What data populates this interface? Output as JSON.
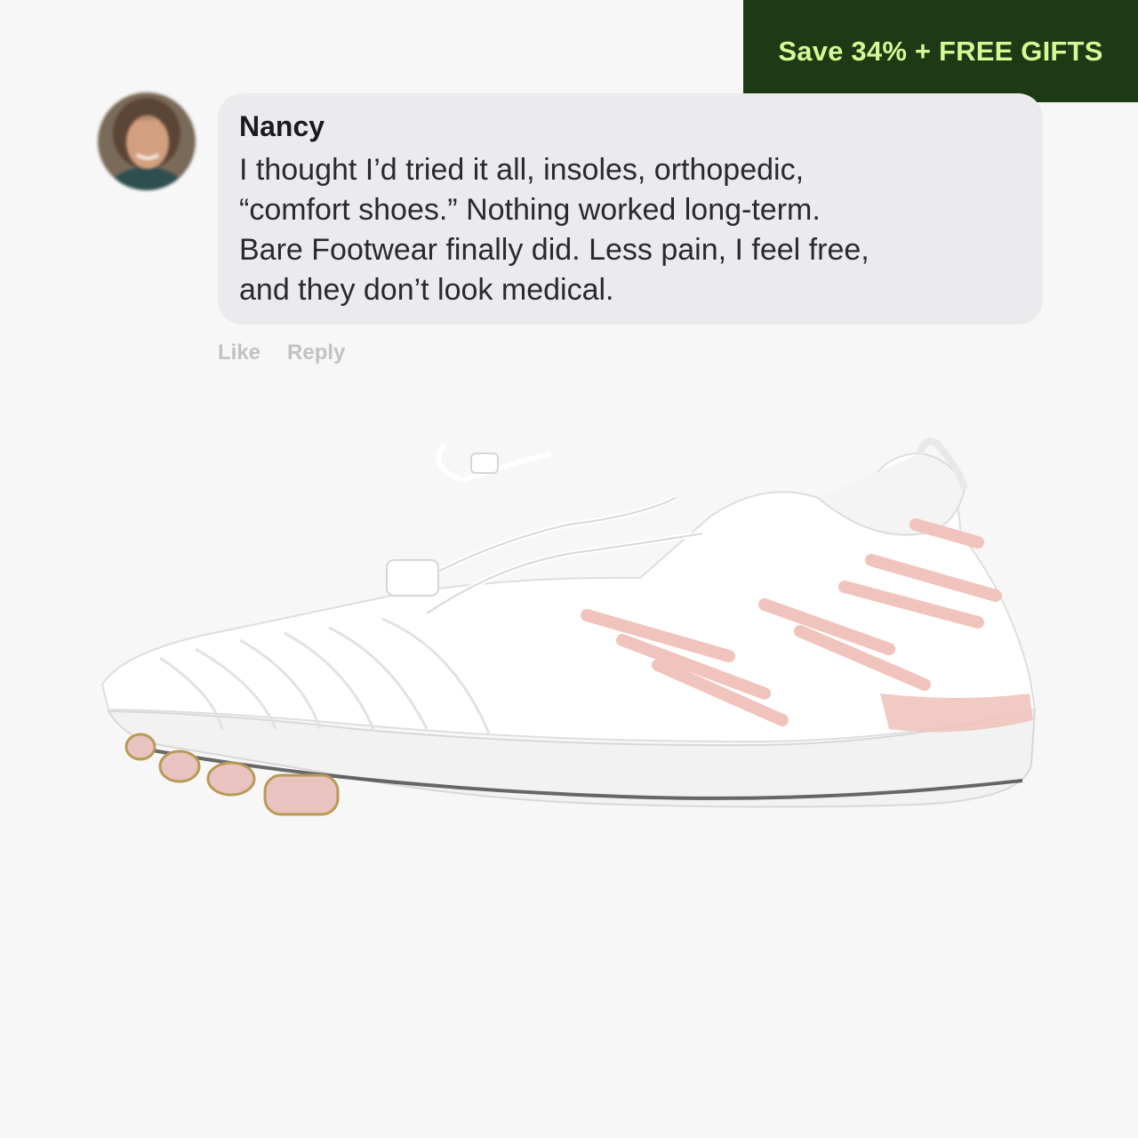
{
  "promo": {
    "label": "Save 34% + FREE GIFTS"
  },
  "comment": {
    "author": "Nancy",
    "text_lines": [
      "I thought I’d tried it all, insoles, orthopedic,",
      "“comfort shoes.”  Nothing worked long-term.",
      "Bare Footwear finally did. Less pain, I feel free,",
      "and they don’t look medical."
    ],
    "actions": {
      "like": "Like",
      "reply": "Reply"
    }
  },
  "colors": {
    "promo_background": "#1c3a14",
    "promo_text": "#d4f995",
    "bubble_background": "#ebebee",
    "page_background": "#f7f7f7",
    "shoe_accent": "#f0c4bc"
  }
}
